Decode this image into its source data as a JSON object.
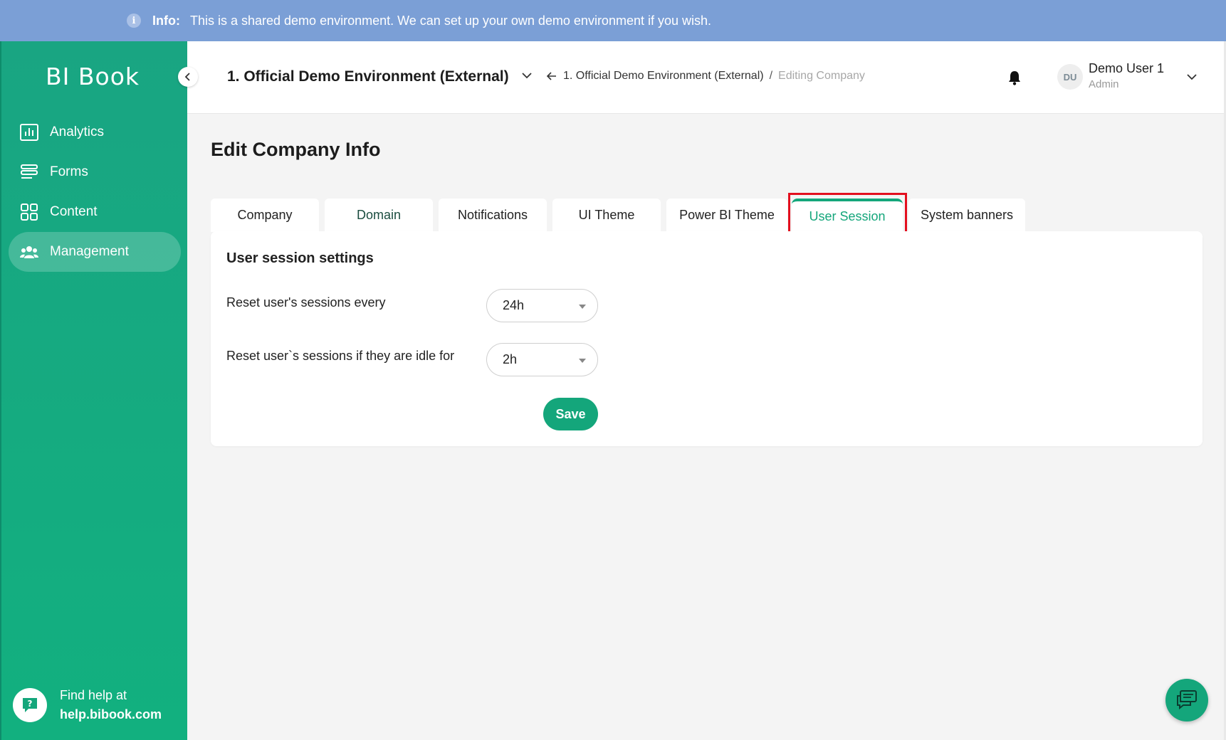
{
  "banner": {
    "icon": "info-icon",
    "label": "Info:",
    "message": "This is a shared demo environment. We can set up your own demo environment if you wish."
  },
  "sidebar": {
    "logo": "BI Book",
    "items": [
      {
        "label": "Analytics",
        "icon": "analytics-chart-icon"
      },
      {
        "label": "Forms",
        "icon": "forms-list-icon"
      },
      {
        "label": "Content",
        "icon": "content-grid-icon"
      },
      {
        "label": "Management",
        "icon": "users-group-icon",
        "active": true
      }
    ],
    "help": {
      "line1": "Find help at",
      "line2": "help.bibook.com",
      "icon": "help-chat-icon"
    }
  },
  "header": {
    "env_title": "1. Official Demo Environment (External)",
    "breadcrumb": {
      "link": "1. Official Demo Environment (External)",
      "separator": "/",
      "current": "Editing Company"
    },
    "user": {
      "initials": "DU",
      "name": "Demo User 1",
      "role": "Admin"
    }
  },
  "main": {
    "title": "Edit Company Info",
    "tabs": [
      {
        "label": "Company"
      },
      {
        "label": "Domain"
      },
      {
        "label": "Notifications"
      },
      {
        "label": "UI Theme"
      },
      {
        "label": "Power BI Theme"
      },
      {
        "label": "User Session",
        "active": true
      },
      {
        "label": "System banners"
      }
    ],
    "card": {
      "title": "User session settings",
      "fields": [
        {
          "label": "Reset user's sessions every",
          "value": "24h"
        },
        {
          "label": "Reset user`s sessions if they are idle for",
          "value": "2h"
        }
      ],
      "save_label": "Save"
    }
  },
  "colors": {
    "accent": "#14a67b",
    "banner": "#7b9fd6",
    "highlight": "#e30f1e"
  }
}
